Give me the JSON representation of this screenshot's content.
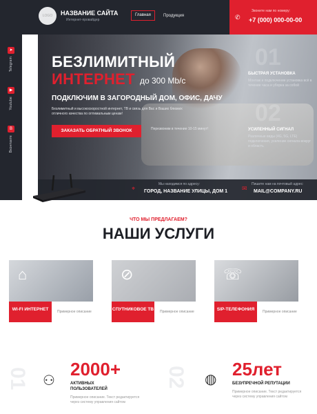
{
  "sidebar": {
    "items": [
      {
        "label": "Telegram",
        "icon": "telegram-icon"
      },
      {
        "label": "Youtube",
        "icon": "youtube-icon"
      },
      {
        "label": "Вконтакте",
        "icon": "vk-icon"
      }
    ]
  },
  "header": {
    "logo_text": "LOGO",
    "site_name": "НАЗВАНИЕ САЙТА",
    "site_sub": "Интернет-провайдер",
    "nav": [
      "Главная",
      "Продукция"
    ],
    "call_label": "Звоните нам по номеру:",
    "phone": "+7 (000) 000-00-00"
  },
  "hero": {
    "title_line1": "БЕЗЛИМИТНЫЙ",
    "title_line2": "ИНТЕРНЕТ",
    "title_speed": "до 300 Мb/c",
    "subtitle": "ПОДКЛЮЧИМ В ЗАГОРОДНЫЙ ДОМ, ОФИС, ДАЧУ",
    "description": "Безлимитный и высокоскоростной интернет, ТВ и связь для Вас и Ваших близких отличного качества по оптимальным ценам!",
    "cta": "ЗАКАЗАТЬ ОБРАТНЫЙ ЗВОНОК",
    "cta_note": "Перезвоним в течение 10-15 минут!",
    "features": [
      {
        "num": "01",
        "title": "БЫСТРАЯ УСТАНОВКА",
        "desc": "Монтаж и подключение установка всё в течение часа и уборка за собой"
      },
      {
        "num": "02",
        "title": "УСИЛЕННЫЙ СИГНАЛ",
        "desc": "Различные виды (4G, 5G, LTE) подключения, усиление сигнала вокруг и область"
      }
    ],
    "footer": {
      "address_label": "Мы находимся по адресу:",
      "address": "ГОРОД, НАЗВАНИЕ УЛИЦЫ, ДОМ 1",
      "mail_label": "Пишите нам на почтовый адрес:",
      "mail": "MAIL@COMPANY.RU"
    }
  },
  "services": {
    "subtitle": "ЧТО МЫ ПРЕДЛАГАЕМ?",
    "title": "НАШИ УСЛУГИ",
    "cards": [
      {
        "title": "WI-FI ИНТЕРНЕТ",
        "desc": "Примерное описание",
        "icon": "wifi-router-icon"
      },
      {
        "title": "СПУТНИКОВОЕ ТВ",
        "desc": "Примерное описание",
        "icon": "satellite-icon"
      },
      {
        "title": "SIP-ТЕЛЕФОНИЯ",
        "desc": "Примерное описание",
        "icon": "phone-icon"
      }
    ]
  },
  "stats": [
    {
      "num": "01",
      "value": "2000+",
      "label": "АКТИВНЫХ ПОЛЬЗОВАТЕЛЕЙ",
      "desc": "Примерное описание. Текст редактируется через систему управления сайтом",
      "icon": "users-icon"
    },
    {
      "num": "02",
      "value": "25лет",
      "label": "БЕЗУПРЕЧНОЙ РЕПУТАЦИИ",
      "desc": "Примерное описание. Текст редактируется через систему управления сайтом",
      "icon": "globe-icon"
    }
  ],
  "colors": {
    "accent": "#e0202e",
    "dark": "#23262e"
  }
}
